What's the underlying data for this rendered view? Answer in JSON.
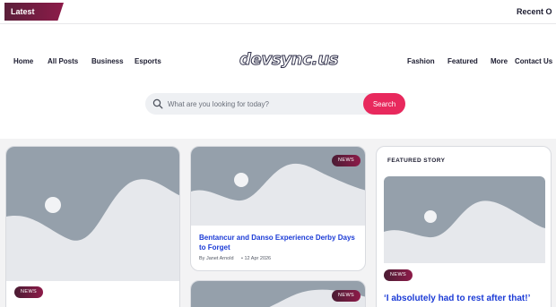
{
  "topbar": {
    "latest_label": "Latest Update",
    "recent_label": "Recent O"
  },
  "nav": {
    "left": [
      "Home",
      "All Posts",
      "Business",
      "Esports"
    ],
    "logo": "devsync.us",
    "right": [
      "Fashion",
      "Featured",
      "More",
      "Contact Us"
    ]
  },
  "search": {
    "placeholder": "What are you looking for today?",
    "button_label": "Search"
  },
  "posts": [
    {
      "badge": "NEWS"
    },
    {
      "badge": "NEWS",
      "title": "Bentancur and Danso Experience Derby Days to Forget",
      "author": "By Janet Arnold",
      "date": "• 12 Apr 2026"
    },
    {
      "badge": "NEWS"
    }
  ],
  "featured": {
    "label": "FEATURED STORY",
    "badge": "NEWS",
    "title": "‘I absolutely had to rest after that!’"
  },
  "colors": {
    "accent": "#e8295d",
    "badge": "#8d1b49",
    "link": "#1b3bd6",
    "placeholder": "#95a0ab"
  }
}
